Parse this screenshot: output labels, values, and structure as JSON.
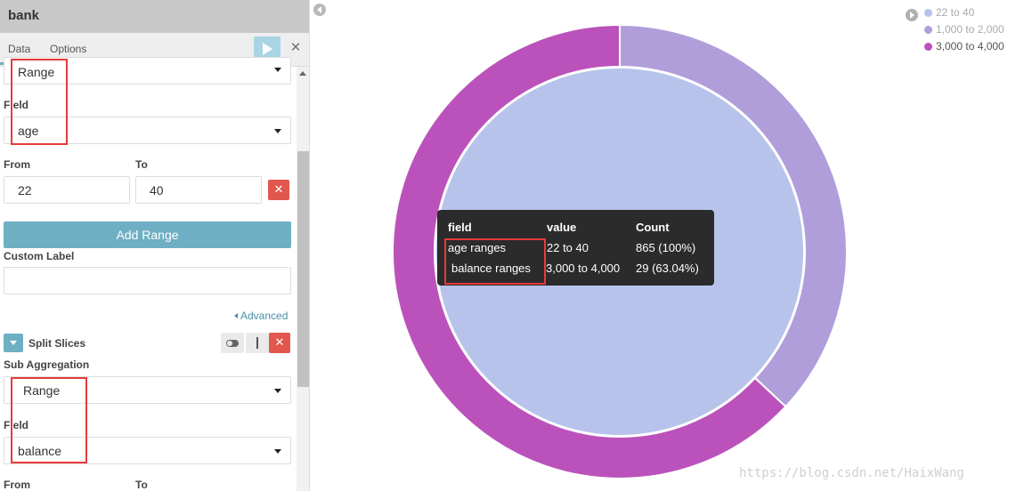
{
  "panel": {
    "title": "bank",
    "tabs": [
      "Data",
      "Options"
    ],
    "discard_glyph": "✕",
    "first_aggregation_select": "Range",
    "field_label_1": "Field",
    "field_value_1": "age",
    "from_label": "From",
    "to_label": "To",
    "range_from": "22",
    "range_to": "40",
    "remove_glyph": "✕",
    "add_range_label": "Add Range",
    "custom_label_title": "Custom Label",
    "custom_label_value": "",
    "advanced_link": "Advanced",
    "split_slices_title": "Split Slices",
    "move_glyph": "↕",
    "sub_aggregation_label": "Sub Aggregation",
    "sub_aggregation_value": "Range",
    "field_label_2": "Field",
    "field_value_2": "balance",
    "from_label_2": "From",
    "to_label_2": "To"
  },
  "legend": {
    "items": [
      {
        "label": "22 to 40",
        "color": "#b7c3eb"
      },
      {
        "label": "1,000 to 2,000",
        "color": "#b09edb"
      },
      {
        "label": "3,000 to 4,000",
        "color": "#bb52bb"
      }
    ]
  },
  "tooltip": {
    "headers": [
      "field",
      "value",
      "Count"
    ],
    "rows": [
      {
        "field": "age ranges",
        "value": "22 to 40",
        "count": "865 (100%)"
      },
      {
        "field": "balance ranges",
        "value": "3,000 to 4,000",
        "count": "29 (63.04%)"
      }
    ]
  },
  "chart_data": {
    "type": "pie",
    "inner_ring": [
      {
        "label": "22 to 40",
        "percent": 100
      }
    ],
    "outer_ring": [
      {
        "label": "1,000 to 2,000",
        "percent": 36.96
      },
      {
        "label": "3,000 to 4,000",
        "percent": 63.04
      }
    ]
  },
  "watermark": "https://blog.csdn.net/HaixWang",
  "colors": {
    "accent": "#6fafc3",
    "danger": "#e1574e",
    "highlight": "#e83a3a"
  }
}
